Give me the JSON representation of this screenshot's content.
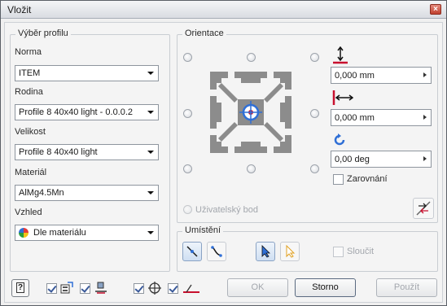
{
  "window": {
    "title": "Vložit",
    "close_glyph": "×"
  },
  "profile_group": {
    "legend": "Výběr profilu",
    "norma_label": "Norma",
    "norma_value": "ITEM",
    "rodina_label": "Rodina",
    "rodina_value": "Profile 8 40x40 light - 0.0.0.2",
    "velikost_label": "Velikost",
    "velikost_value": "Profile 8 40x40 light",
    "material_label": "Materiál",
    "material_value": "AlMg4.5Mn",
    "vzhled_label": "Vzhled",
    "vzhled_value": "Dle materiálu"
  },
  "orientation_group": {
    "legend": "Orientace",
    "offset_vertical": "0,000 mm",
    "offset_horizontal": "0,000 mm",
    "rotation": "0,00 deg",
    "align_label": "Zarovnání",
    "user_point_label": "Uživatelský bod"
  },
  "placement_group": {
    "legend": "Umístění",
    "merge_label": "Sloučit"
  },
  "buttons": {
    "ok": "OK",
    "cancel": "Storno",
    "apply": "Použít",
    "help": "?"
  },
  "colors": {
    "accent": "#2f6fd6",
    "red_marker": "#c8102e",
    "profile_gray": "#8c8c8c",
    "title_bar": "#dde0e5"
  },
  "icons": {
    "vertical_offset": "vertical-offset-icon",
    "horizontal_offset": "horizontal-offset-icon",
    "rotation": "rotate-icon",
    "flip": "flip-icon",
    "axis_line": "axis-line-icon",
    "curve_path": "curve-path-icon",
    "select_arrow": "select-arrow-icon",
    "select_arrow_outline": "select-arrow-outline-icon"
  }
}
